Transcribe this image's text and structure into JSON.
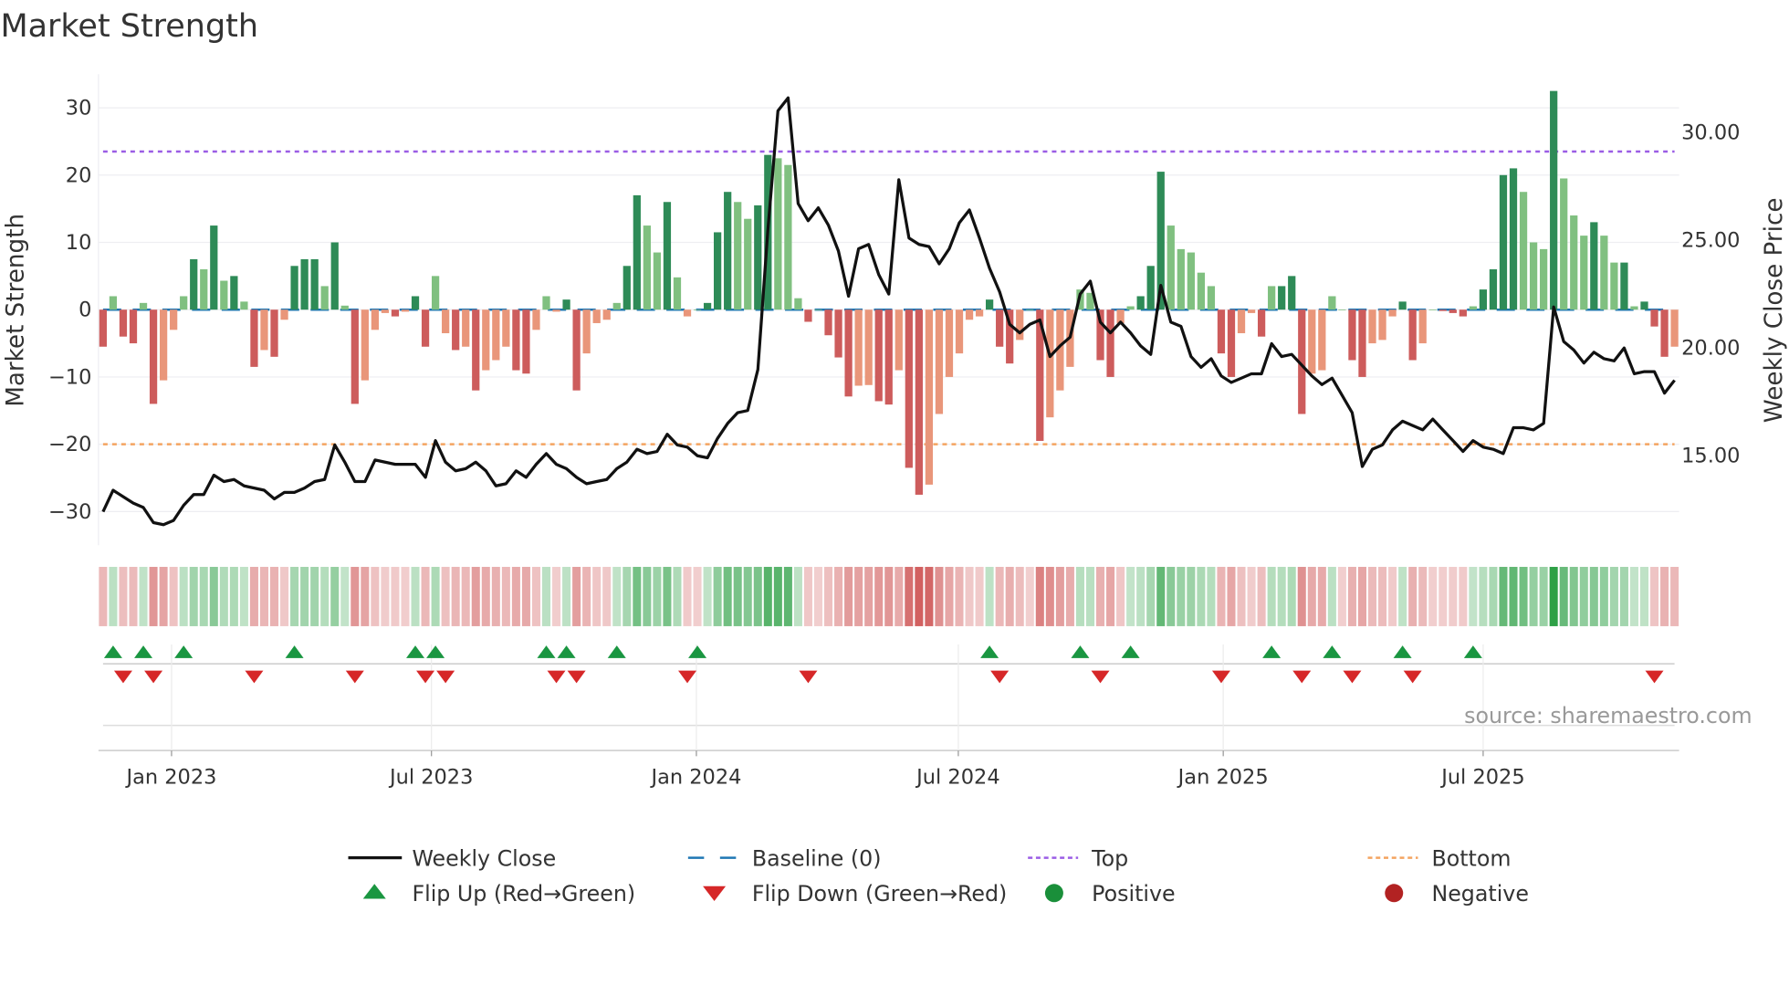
{
  "chart_data": {
    "type": "bar",
    "title": "Market Strength",
    "ylabel": "Market Strength",
    "y2label": "Weekly Close Price",
    "ylim": [
      -35,
      35
    ],
    "y2lim": [
      10.85,
      32.7
    ],
    "yticks": [
      30,
      20,
      10,
      0,
      -10,
      -20,
      -30
    ],
    "ytick_labels": [
      "30",
      "20",
      "10",
      "0",
      "−10",
      "−20",
      "−30"
    ],
    "y2ticks": [
      30,
      25,
      20,
      15
    ],
    "y2tick_labels": [
      "30.00",
      "25.00",
      "20.00",
      "15.00"
    ],
    "xticks": [
      {
        "label": "Jan 2023",
        "week": 6.8
      },
      {
        "label": "Jul 2023",
        "week": 32.6
      },
      {
        "label": "Jan 2024",
        "week": 58.9
      },
      {
        "label": "Jul 2024",
        "week": 84.9
      },
      {
        "label": "Jan 2025",
        "week": 111.2
      },
      {
        "label": "Jul 2025",
        "week": 137.0
      }
    ],
    "top_level": 23.5,
    "bottom_level": -20,
    "baseline": 0,
    "strength": [
      -5.5,
      2,
      -4,
      -5,
      1,
      -14,
      -10.5,
      -3,
      2,
      7.5,
      6,
      12.5,
      4.3,
      5,
      1.2,
      -8.5,
      -6,
      -7,
      -1.5,
      6.5,
      7.5,
      7.5,
      3.5,
      10,
      0.6,
      -14,
      -10.5,
      -3,
      -0.5,
      -1,
      -0.3,
      2,
      -5.5,
      5,
      -3.5,
      -6,
      -5.5,
      -12,
      -9,
      -7.5,
      -5.5,
      -9,
      -9.5,
      -3,
      2,
      -0.3,
      1.5,
      -12,
      -6.5,
      -2,
      -1.5,
      1,
      6.5,
      17,
      12.5,
      8.5,
      16,
      4.8,
      -1,
      0,
      1,
      11.5,
      17.5,
      16,
      13.5,
      15.5,
      23,
      22.5,
      21.5,
      1.7,
      -1.8,
      0,
      -3.8,
      -7.1,
      -12.9,
      -11.3,
      -11.2,
      -13.6,
      -14.1,
      -9,
      -23.5,
      -27.5,
      -26,
      -15.5,
      -10,
      -6.5,
      -1.5,
      -1,
      1.5,
      -5.5,
      -8,
      -4.5,
      0,
      -19.5,
      -16,
      -12,
      -8.5,
      3,
      2.5,
      -7.5,
      -10,
      -2,
      0.5,
      2,
      6.5,
      20.5,
      12.5,
      9,
      8.5,
      5.5,
      3.5,
      -6.5,
      -10,
      -3.5,
      -0.5,
      -4,
      3.5,
      3.5,
      5,
      -15.5,
      -9.5,
      -9,
      2,
      0,
      -7.5,
      -10,
      -5,
      -4.5,
      -1,
      1.2,
      -7.5,
      -5,
      0,
      -0.2,
      -0.5,
      -1,
      0.5,
      3,
      6,
      20,
      21,
      17.5,
      10,
      9,
      32.5,
      19.5,
      14,
      11,
      13,
      11,
      7,
      7,
      0.5,
      1.2,
      -2.5,
      -7,
      -5.5
    ],
    "weekly_close": [
      12.4,
      13.4,
      13.1,
      12.8,
      12.6,
      11.9,
      11.8,
      12.0,
      12.7,
      13.2,
      13.2,
      14.1,
      13.8,
      13.9,
      13.6,
      13.5,
      13.4,
      13.0,
      13.3,
      13.3,
      13.5,
      13.8,
      13.9,
      15.5,
      14.7,
      13.8,
      13.8,
      14.8,
      14.7,
      14.6,
      14.6,
      14.6,
      14.0,
      15.7,
      14.7,
      14.3,
      14.4,
      14.7,
      14.3,
      13.6,
      13.7,
      14.3,
      14.0,
      14.6,
      15.1,
      14.6,
      14.4,
      14.0,
      13.7,
      13.8,
      13.9,
      14.4,
      14.7,
      15.3,
      15.1,
      15.2,
      16.0,
      15.5,
      15.4,
      15.0,
      14.9,
      15.8,
      16.5,
      17.0,
      17.1,
      19.0,
      25.5,
      31.0,
      31.6,
      26.7,
      25.9,
      26.5,
      25.7,
      24.5,
      22.4,
      24.6,
      24.8,
      23.4,
      22.5,
      27.8,
      25.1,
      24.8,
      24.7,
      23.9,
      24.6,
      25.8,
      26.4,
      25.1,
      23.7,
      22.6,
      21.1,
      20.7,
      21.1,
      21.3,
      19.6,
      20.1,
      20.5,
      22.5,
      23.1,
      21.2,
      20.7,
      21.2,
      20.7,
      20.1,
      19.7,
      22.9,
      21.2,
      21.0,
      19.6,
      19.1,
      19.5,
      18.7,
      18.4,
      18.6,
      18.8,
      18.8,
      20.2,
      19.6,
      19.7,
      19.2,
      18.7,
      18.3,
      18.6,
      17.8,
      17.0,
      14.5,
      15.3,
      15.5,
      16.2,
      16.6,
      16.4,
      16.2,
      16.7,
      16.2,
      15.7,
      15.2,
      15.7,
      15.4,
      15.3,
      15.1,
      16.3,
      16.3,
      16.2,
      16.5,
      21.9,
      20.3,
      19.9,
      19.3,
      19.8,
      19.5,
      19.4,
      20.0,
      18.8,
      18.9,
      18.9,
      17.9,
      18.5
    ],
    "flip_up_weeks": [
      1,
      4,
      8,
      19,
      31,
      33,
      44,
      46,
      51,
      59,
      88,
      97,
      102,
      116,
      122,
      129,
      136
    ],
    "flip_down_weeks": [
      2,
      5,
      15,
      25,
      32,
      34,
      45,
      47,
      58,
      70,
      89,
      99,
      111,
      119,
      124,
      130,
      154
    ],
    "legend": [
      {
        "label": "Weekly Close",
        "key": "line"
      },
      {
        "label": "Baseline (0)",
        "key": "dash"
      },
      {
        "label": "Top",
        "key": "dot-top"
      },
      {
        "label": "Bottom",
        "key": "dot-bottom"
      },
      {
        "label": "Flip Up (Red→Green)",
        "key": "tri-up"
      },
      {
        "label": "Flip Down (Green→Red)",
        "key": "tri-down"
      },
      {
        "label": "Positive",
        "key": "dot-pos"
      },
      {
        "label": "Negative",
        "key": "dot-neg"
      }
    ],
    "legend_position": "bottom",
    "source": "source: sharemaestro.com"
  },
  "colors": {
    "pos_strong": "#2e8b57",
    "pos_weak": "#80c080",
    "neg_strong": "#cd5c5c",
    "neg_weak": "#e9967a",
    "top": "#9b5de5",
    "bottom": "#f4a460",
    "baseline": "#1f77b4",
    "close": "#111111",
    "flip_up": "#1a9641",
    "flip_down": "#d62728",
    "positive": "#1a8f3a",
    "negative": "#b22222"
  }
}
